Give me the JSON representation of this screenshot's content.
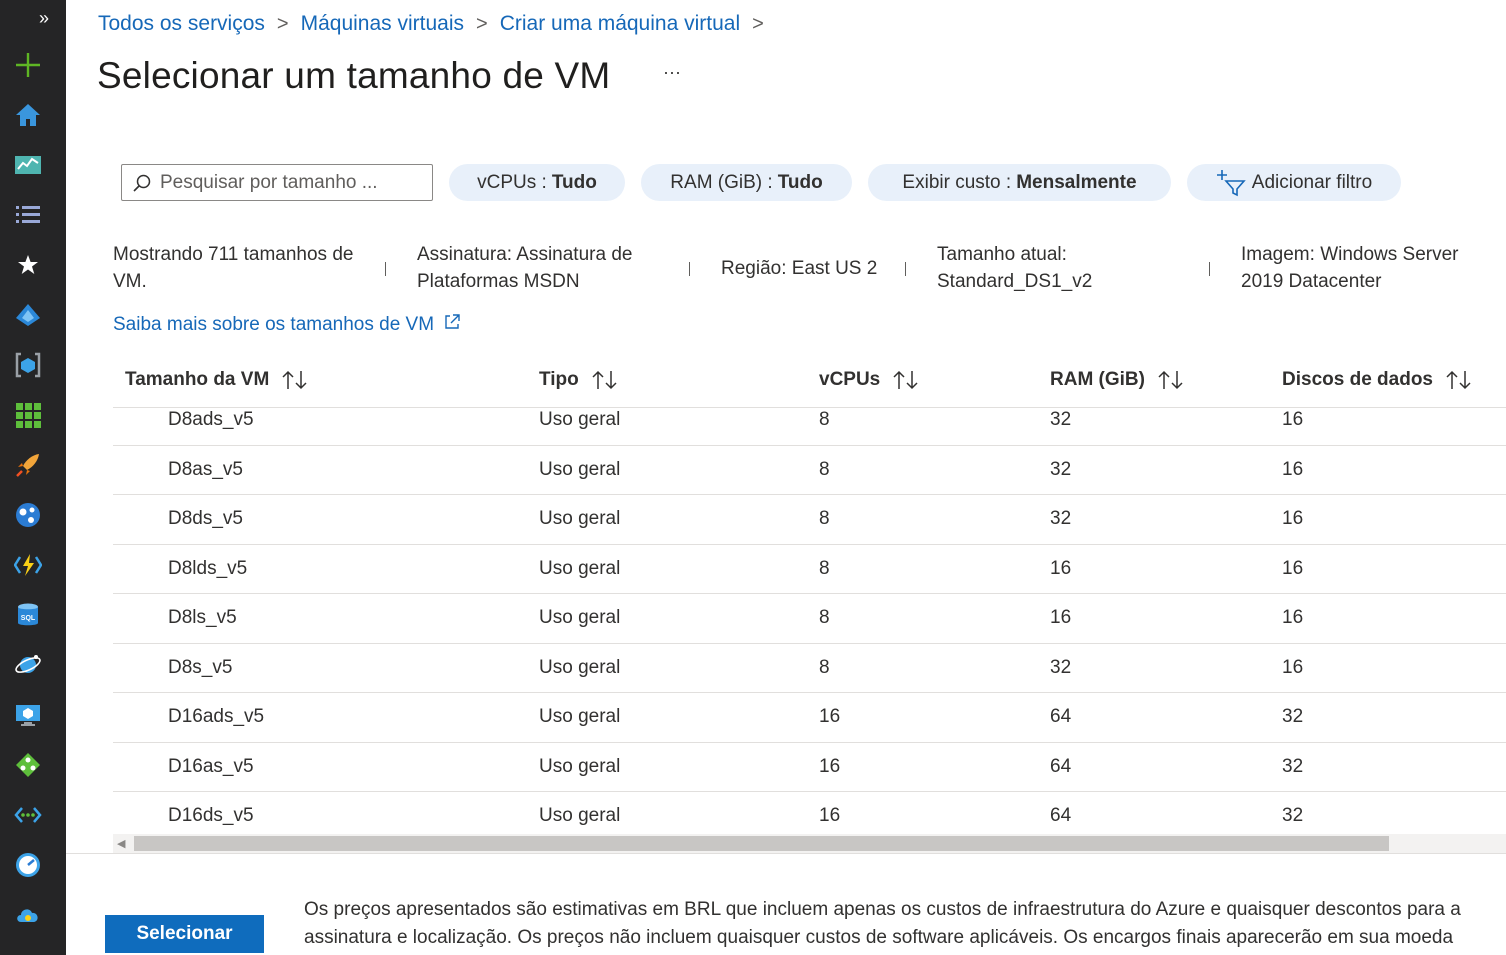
{
  "breadcrumb": {
    "items": [
      "Todos os serviços",
      "Máquinas virtuais",
      "Criar uma máquina virtual"
    ],
    "separator": ">"
  },
  "page": {
    "title": "Selecionar um tamanho de VM",
    "more": "···"
  },
  "search": {
    "placeholder": "Pesquisar por tamanho ..."
  },
  "filters": {
    "vcpus": {
      "label": "vCPUs :",
      "value": "Tudo"
    },
    "ram": {
      "label": "RAM (GiB) :",
      "value": "Tudo"
    },
    "cost": {
      "label": "Exibir custo :",
      "value": "Mensalmente"
    },
    "add": {
      "label": "Adicionar filtro"
    }
  },
  "info": {
    "showing": "Mostrando 711 tamanhos de VM.",
    "subscription": "Assinatura: Assinatura de Plataformas MSDN",
    "region": "Região: East US 2",
    "current_size": "Tamanho atual: Standard_DS1_v2",
    "image": "Imagem: Windows Server 2019 Datacenter",
    "learn_more": "Saiba mais sobre os tamanhos de VM"
  },
  "table": {
    "columns": [
      "Tamanho da VM",
      "Tipo",
      "vCPUs",
      "RAM (GiB)",
      "Discos de dados"
    ],
    "rows": [
      [
        "D8ads_v5",
        "Uso geral",
        "8",
        "32",
        "16"
      ],
      [
        "D8as_v5",
        "Uso geral",
        "8",
        "32",
        "16"
      ],
      [
        "D8ds_v5",
        "Uso geral",
        "8",
        "32",
        "16"
      ],
      [
        "D8lds_v5",
        "Uso geral",
        "8",
        "16",
        "16"
      ],
      [
        "D8ls_v5",
        "Uso geral",
        "8",
        "16",
        "16"
      ],
      [
        "D8s_v5",
        "Uso geral",
        "8",
        "32",
        "16"
      ],
      [
        "D16ads_v5",
        "Uso geral",
        "16",
        "64",
        "32"
      ],
      [
        "D16as_v5",
        "Uso geral",
        "16",
        "64",
        "32"
      ],
      [
        "D16ds_v5",
        "Uso geral",
        "16",
        "64",
        "32"
      ]
    ]
  },
  "footer": {
    "select_label": "Selecionar",
    "line1": "Os preços apresentados são estimativas em BRL que incluem apenas os custos de infraestrutura do Azure e quaisquer descontos para a",
    "line2": "assinatura e localização. Os preços não incluem quaisquer custos de software aplicáveis. Os encargos finais aparecerão em sua moeda"
  },
  "sidebar": {
    "icons": [
      "create-resource-icon",
      "home-icon",
      "dashboard-icon",
      "all-services-icon",
      "favorites-icon",
      "azure-ad-icon",
      "resource-group-icon",
      "all-resources-icon",
      "quickstart-icon",
      "app-services-icon",
      "function-app-icon",
      "sql-database-icon",
      "cosmos-db-icon",
      "virtual-machines-icon",
      "load-balancer-icon",
      "virtual-network-icon",
      "monitor-icon",
      "cloud-services-icon"
    ]
  },
  "colors": {
    "accent": "#0f6cbd",
    "sidebar": "#252526",
    "pill": "#e8f0fa"
  }
}
